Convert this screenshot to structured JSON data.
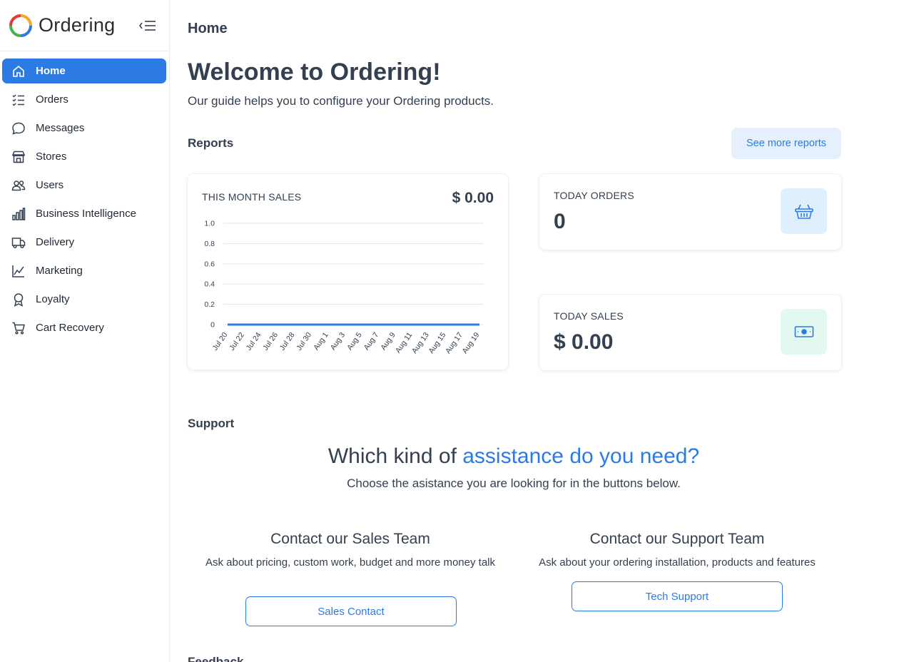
{
  "app": {
    "name": "Ordering"
  },
  "sidebar": {
    "items": [
      {
        "label": "Home",
        "icon": "home-icon",
        "active": true
      },
      {
        "label": "Orders",
        "icon": "list-check-icon"
      },
      {
        "label": "Messages",
        "icon": "chat-bubble-icon"
      },
      {
        "label": "Stores",
        "icon": "shop-icon"
      },
      {
        "label": "Users",
        "icon": "people-icon"
      },
      {
        "label": "Business Intelligence",
        "icon": "bar-chart-icon"
      },
      {
        "label": "Delivery",
        "icon": "truck-icon"
      },
      {
        "label": "Marketing",
        "icon": "graph-up-icon"
      },
      {
        "label": "Loyalty",
        "icon": "award-icon"
      },
      {
        "label": "Cart Recovery",
        "icon": "cart-icon"
      }
    ]
  },
  "header": {
    "title": "Home"
  },
  "welcome": {
    "title": "Welcome to Ordering!",
    "subtitle": "Our guide helps you to configure your Ordering products."
  },
  "reports": {
    "title": "Reports",
    "see_more_label": "See more reports",
    "this_month_sales": {
      "label": "THIS MONTH SALES",
      "value": "$ 0.00"
    },
    "today_orders": {
      "label": "TODAY ORDERS",
      "value": "0",
      "icon": "basket-icon"
    },
    "today_sales": {
      "label": "TODAY SALES",
      "value": "$ 0.00",
      "icon": "cash-icon"
    }
  },
  "chart_data": {
    "type": "line",
    "categories": [
      "Jul 20",
      "Jul 22",
      "Jul 24",
      "Jul 26",
      "Jul 28",
      "Jul 30",
      "Aug 1",
      "Aug 3",
      "Aug 5",
      "Aug 7",
      "Aug 9",
      "Aug 11",
      "Aug 13",
      "Aug 15",
      "Aug 17",
      "Aug 19"
    ],
    "series": [
      {
        "values": [
          0,
          0,
          0,
          0,
          0,
          0,
          0,
          0,
          0,
          0,
          0,
          0,
          0,
          0,
          0,
          0
        ]
      }
    ],
    "y_ticks": [
      "0",
      "0.2",
      "0.4",
      "0.6",
      "0.8",
      "1.0"
    ],
    "ylim": [
      0,
      1
    ],
    "grid": true,
    "line_color": "#2c7be5"
  },
  "support": {
    "title": "Support",
    "heading_part1": "Which kind of ",
    "heading_accent": "assistance do you need?",
    "subtitle": "Choose the asistance you are looking for in the buttons below.",
    "sales": {
      "title": "Contact our Sales Team",
      "description": "Ask about pricing, custom work, budget and more money talk",
      "button": "Sales Contact"
    },
    "tech": {
      "title": "Contact our Support Team",
      "description": "Ask about your ordering installation, products and features",
      "button": "Tech Support"
    }
  },
  "feedback": {
    "title": "Feedback"
  },
  "colors": {
    "accent": "#2c7be5",
    "text": "#344050"
  }
}
